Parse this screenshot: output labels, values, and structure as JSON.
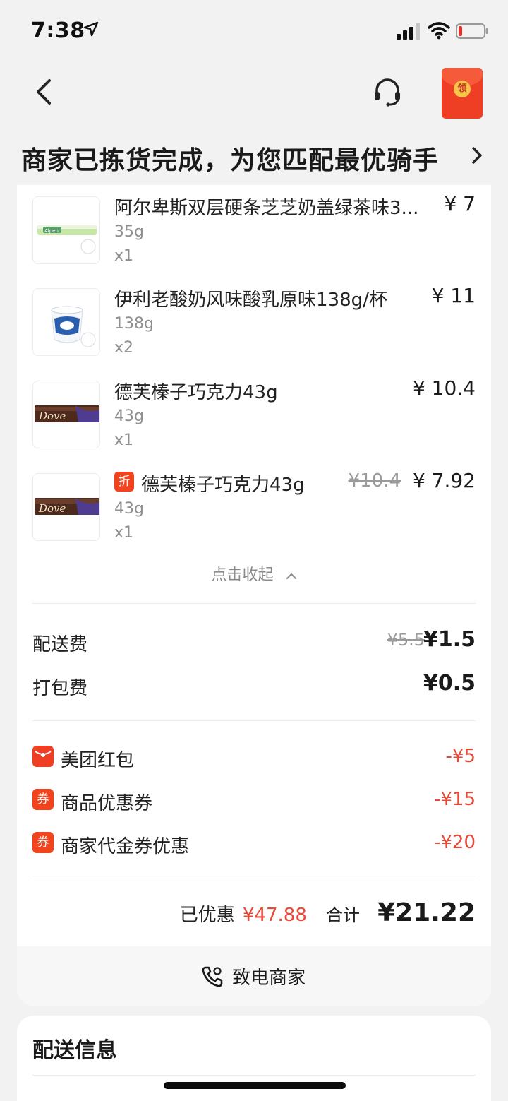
{
  "status_bar": {
    "time": "7:38"
  },
  "header": {
    "redpacket_label": "领",
    "status_title": "商家已拣货完成，为您匹配最优骑手"
  },
  "products": [
    {
      "name": "阿尔卑斯双层硬条芝芝奶盖绿茶味3...",
      "spec": "35g",
      "qty": "x1",
      "price": "¥ 7",
      "thumb": "alpenliebe-candy"
    },
    {
      "name": "伊利老酸奶风味酸乳原味138g/杯",
      "spec": "138g",
      "qty": "x2",
      "price": "¥ 11",
      "thumb": "yili-yogurt-cup"
    },
    {
      "name": "德芙榛子巧克力43g",
      "spec": "43g",
      "qty": "x1",
      "price": "¥ 10.4",
      "thumb": "dove-chocolate"
    },
    {
      "name": "德芙榛子巧克力43g",
      "spec": "43g",
      "qty": "x1",
      "price": "¥ 7.92",
      "old_price": "¥10.4",
      "tag": "折",
      "thumb": "dove-chocolate"
    }
  ],
  "collapse_label": "点击收起",
  "fees": {
    "delivery": {
      "label": "配送费",
      "old": "¥5.5",
      "value": "¥1.5"
    },
    "packing": {
      "label": "打包费",
      "value": "¥0.5"
    }
  },
  "promos": [
    {
      "icon": "red-packet-icon",
      "label": "美团红包",
      "value": "-¥5"
    },
    {
      "icon": "coupon-icon",
      "icon_text": "券",
      "label": "商品优惠券",
      "value": "-¥15"
    },
    {
      "icon": "coupon-icon",
      "icon_text": "券",
      "label": "商家代金券优惠",
      "value": "-¥20"
    }
  ],
  "summary": {
    "saved_label": "已优惠",
    "saved_value": "¥47.88",
    "total_label": "合计",
    "total_value": "¥21.22"
  },
  "call_merchant": "致电商家",
  "delivery_info": {
    "title": "配送信息"
  },
  "colors": {
    "accent_red": "#e84a36",
    "tag_orange": "#f0431e",
    "packet_red": "#ee3f24"
  }
}
